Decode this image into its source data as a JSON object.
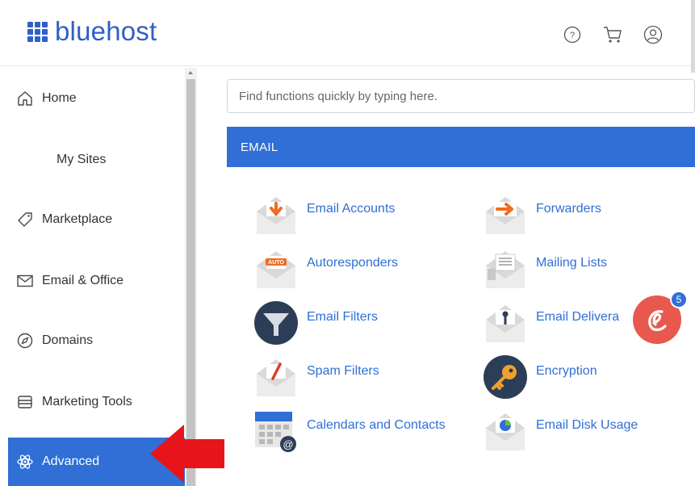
{
  "brand": {
    "name": "bluehost",
    "color": "#2f5fc8"
  },
  "header": {
    "icons": [
      "help-icon",
      "cart-icon",
      "account-icon"
    ]
  },
  "sidebar": {
    "items": [
      {
        "label": "Home",
        "icon": "home-icon"
      },
      {
        "label": "My Sites",
        "icon": ""
      },
      {
        "label": "Marketplace",
        "icon": "tag-icon"
      },
      {
        "label": "Email & Office",
        "icon": "envelope-icon"
      },
      {
        "label": "Domains",
        "icon": "compass-icon"
      },
      {
        "label": "Marketing Tools",
        "icon": "tray-icon"
      },
      {
        "label": "Advanced",
        "icon": "atom-icon",
        "active": true
      }
    ],
    "active_color": "#2f6fd6"
  },
  "search": {
    "placeholder": "Find functions quickly by typing here."
  },
  "section": {
    "title": "EMAIL",
    "color": "#2f6fd6"
  },
  "tools": {
    "left": [
      {
        "label": "Email Accounts",
        "icon": "email-accounts-icon"
      },
      {
        "label": "Autoresponders",
        "icon": "autoresponders-icon",
        "badge": "AUTO"
      },
      {
        "label": "Email Filters",
        "icon": "email-filters-icon"
      },
      {
        "label": "Spam Filters",
        "icon": "spam-filters-icon"
      },
      {
        "label": "Calendars and Contacts",
        "icon": "calendars-contacts-icon"
      }
    ],
    "right": [
      {
        "label": "Forwarders",
        "icon": "forwarders-icon"
      },
      {
        "label": "Mailing Lists",
        "icon": "mailing-lists-icon"
      },
      {
        "label": "Email Delivera",
        "icon": "email-deliverability-icon"
      },
      {
        "label": "Encryption",
        "icon": "encryption-icon"
      },
      {
        "label": "Email Disk Usage",
        "icon": "email-disk-usage-icon"
      }
    ]
  },
  "chat": {
    "count": "5",
    "color": "#e8584f"
  },
  "annotation": {
    "arrow_color": "#e8141c"
  }
}
